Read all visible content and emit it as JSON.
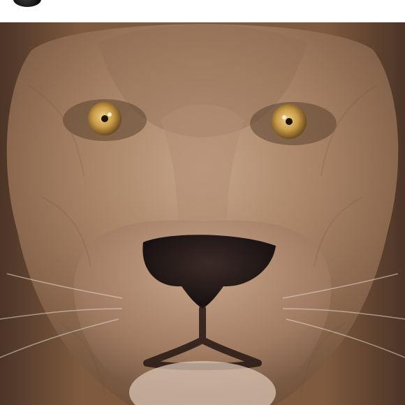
{
  "post": {
    "username": "",
    "image": {
      "subject": "lion-face-closeup-icon"
    }
  },
  "colors": {
    "header_bg": "#ffffff",
    "mane_dark": "#5a4130",
    "mane_mid": "#8a6545",
    "fur_light": "#b08a6c",
    "eye_gold": "#c89b48",
    "nose": "#1b1414"
  }
}
